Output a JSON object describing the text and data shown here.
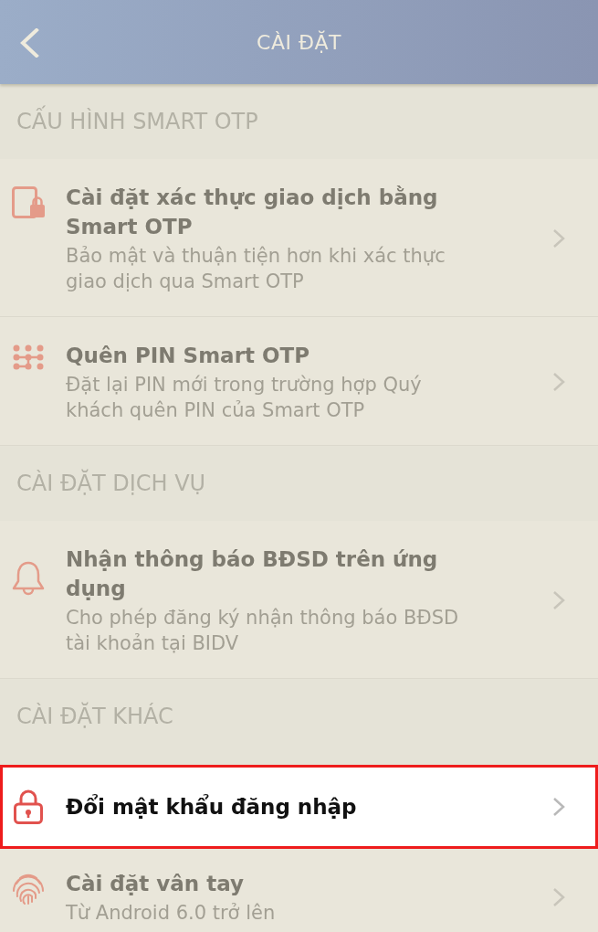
{
  "header": {
    "title": "CÀI ĐẶT"
  },
  "sections": [
    {
      "title": "CẤU HÌNH SMART OTP",
      "items": [
        {
          "title": "Cài đặt xác thực giao dịch bằng Smart OTP",
          "subtitle": "Bảo mật và thuận tiện hơn khi xác thực giao dịch qua Smart OTP",
          "highlighted": false
        },
        {
          "title": "Quên PIN Smart OTP",
          "subtitle": "Đặt lại PIN mới trong trường hợp Quý khách quên PIN của Smart OTP",
          "highlighted": false
        }
      ]
    },
    {
      "title": "CÀI ĐẶT DỊCH VỤ",
      "items": [
        {
          "title": "Nhận thông báo BĐSD trên ứng dụng",
          "subtitle": "Cho phép đăng ký nhận thông báo BĐSD tài khoản tại BIDV",
          "highlighted": false
        }
      ]
    },
    {
      "title": "CÀI ĐẶT KHÁC",
      "items": [
        {
          "title": "Đổi mật khẩu đăng nhập",
          "highlighted": true
        },
        {
          "title": "Cài đặt vân tay",
          "subtitle": "Từ Android 6.0 trở lên",
          "highlighted": false
        }
      ]
    }
  ]
}
